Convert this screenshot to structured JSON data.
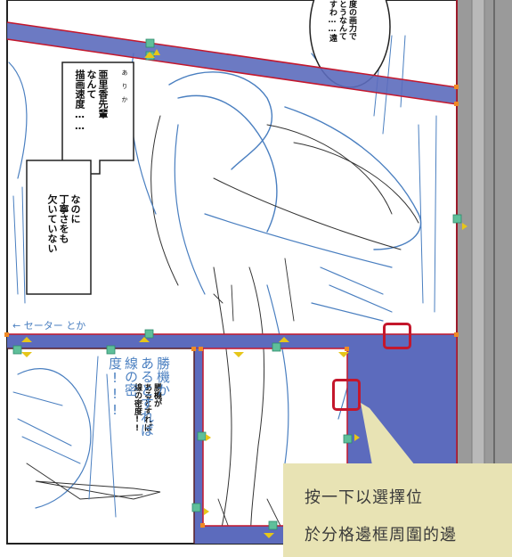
{
  "balloons": {
    "top_right": [
      "度の画力で",
      "とうなんて",
      "すわ……遠"
    ],
    "left_top": [
      "亜里香先輩",
      "なんて",
      "描画速度……"
    ],
    "left_ruby": "あ り か",
    "left_bottom": [
      "なのに",
      "丁寧さをも",
      "欠いていない"
    ],
    "lower_left": [
      "勝機が",
      "あるとすれば",
      "線の密度!!"
    ]
  },
  "handwriting": {
    "sweater_note": "← セーター とか",
    "draft_1": [
      "勝機か",
      "あるとすれば",
      "線の密度!!!"
    ]
  },
  "callout": {
    "line1": "按一下以選擇位",
    "line2": "於分格邊框周圍的邊"
  },
  "colors": {
    "border_fill": "#5c6bbd",
    "border_edge": "#c4172c",
    "handle": "#5fbf9a",
    "arrow": "#e6c619",
    "sketch": "#4a7fc0",
    "gray_panel": "#9a9a9a",
    "callout_bg": "#e8e3b4"
  }
}
